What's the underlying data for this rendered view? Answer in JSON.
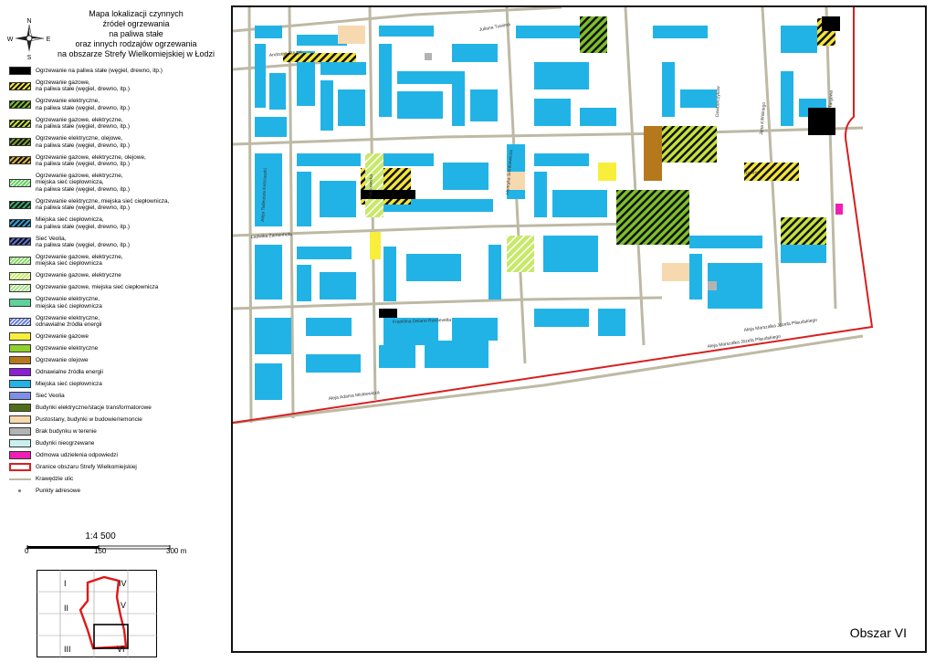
{
  "legend_title": [
    "Mapa lokalizacji czynnych",
    "źródeł ogrzewania",
    "na paliwa stałe",
    "oraz innych rodzajów ogrzewania",
    "na obszarze Strefy Wielkomiejskiej w Łodzi"
  ],
  "compass": {
    "N": "N",
    "S": "S",
    "E": "E",
    "W": "W"
  },
  "legend": [
    {
      "lines": [
        "Ogrzewanie na paliwa stałe (węgiel, drewno, itp.)"
      ],
      "swatch": "solid",
      "color": "#000000"
    },
    {
      "lines": [
        "Ogrzewanie gazowe,",
        "na paliwa stałe (węgiel, drewno, itp.)"
      ],
      "swatch": "hatch",
      "color": "#f5e43a"
    },
    {
      "lines": [
        "Ogrzewanie elektryczne,",
        "na paliwa stałe (węgiel, drewno, itp.)"
      ],
      "swatch": "hatch",
      "color": "#7dbf2b"
    },
    {
      "lines": [
        "Ogrzewanie gazowe, elektryczne,",
        "na paliwa stałe (węgiel, drewno, itp.)"
      ],
      "swatch": "hatch",
      "color": "#c6e03c"
    },
    {
      "lines": [
        "Ogrzewanie elektryczne, olejowe,",
        "na paliwa stałe (węgiel, drewno, itp.)"
      ],
      "swatch": "hatch",
      "color": "#7a9a2a"
    },
    {
      "lines": [
        "Ogrzewanie gazowe, elektryczne, olejowe,",
        "na paliwa stałe (węgiel, drewno, itp.)"
      ],
      "swatch": "hatch",
      "color": "#d9b23a"
    },
    {
      "lines": [
        "Ogrzewanie gazowe, elektryczne,",
        "miejska sieć ciepłownicza,",
        "na paliwa stałe (węgiel, drewno, itp.)"
      ],
      "swatch": "light-hatch",
      "color": "#5fcf5f"
    },
    {
      "lines": [
        "Ogrzewanie elektryczne, miejska sieć ciepłownicza,",
        "na paliwa stałe (węgiel, drewno, itp.)"
      ],
      "swatch": "hatch",
      "color": "#3aa86a"
    },
    {
      "lines": [
        "Miejska sieć ciepłownicza,",
        "na paliwa stałe (węgiel, drewno, itp.)"
      ],
      "swatch": "hatch",
      "color": "#2f9fd8"
    },
    {
      "lines": [
        "Sieć Veolia,",
        "na paliwa stałe (węgiel, drewno, itp.)"
      ],
      "swatch": "hatch",
      "color": "#5a6fd0"
    },
    {
      "lines": [
        "Ogrzewanie gazowe, elektryczne,",
        "miejska sieć ciepłownicza"
      ],
      "swatch": "light-hatch",
      "color": "#8ad86a"
    },
    {
      "lines": [
        "Ogrzewanie gazowe, elektryczne"
      ],
      "swatch": "light-hatch",
      "color": "#c8e86a"
    },
    {
      "lines": [
        "Ogrzewanie gazowe, miejska sieć ciepłownicza"
      ],
      "swatch": "light-hatch",
      "color": "#a7e08a"
    },
    {
      "lines": [
        "Ogrzewanie elektryczne,",
        "miejska sieć ciepłownicza"
      ],
      "swatch": "solid",
      "color": "#5fd19a"
    },
    {
      "lines": [
        "Ogrzewanie elektryczne,",
        "odnawialne źródła energii"
      ],
      "swatch": "light-hatch",
      "color": "#6a7de0"
    },
    {
      "lines": [
        "Ogrzewanie gazowe"
      ],
      "swatch": "solid",
      "color": "#f7ef3a"
    },
    {
      "lines": [
        "Ogrzewanie elektryczne"
      ],
      "swatch": "solid",
      "color": "#8fd12b"
    },
    {
      "lines": [
        "Ogrzewanie olejowe"
      ],
      "swatch": "solid",
      "color": "#b5781c"
    },
    {
      "lines": [
        "Odnawialne źródła energii"
      ],
      "swatch": "solid",
      "color": "#8a1fd6"
    },
    {
      "lines": [
        "Miejska sieć ciepłownicza"
      ],
      "swatch": "solid",
      "color": "#22b3e6"
    },
    {
      "lines": [
        "Sieć Veolia"
      ],
      "swatch": "solid",
      "color": "#7f8fe8"
    },
    {
      "lines": [
        "Budynki elektryczne/stacje transformatorowe"
      ],
      "swatch": "solid",
      "color": "#4f6e1a"
    },
    {
      "lines": [
        "Pustostany, budynki w budowie/remoncie"
      ],
      "swatch": "solid",
      "color": "#f7d9b0"
    },
    {
      "lines": [
        "Brak budynku w terenie"
      ],
      "swatch": "solid",
      "color": "#b3b3b3"
    },
    {
      "lines": [
        "Budynki nieogrzewane"
      ],
      "swatch": "solid",
      "color": "#c9f0f0"
    },
    {
      "lines": [
        "Odmowa udzielenia odpowiedzi"
      ],
      "swatch": "solid",
      "color": "#f01eb4"
    },
    {
      "lines": [
        "Granice obszaru Strefy Wielkomiejskiej"
      ],
      "swatch": "outline",
      "color": "#d62020"
    },
    {
      "lines": [
        "Krawędzie ulic"
      ],
      "swatch": "line",
      "color": "#bdb9a4"
    },
    {
      "lines": [
        "Punkty adresowe"
      ],
      "swatch": "dot",
      "color": "#777777"
    }
  ],
  "scale": {
    "ratio": "1:4 500",
    "tick0": "0",
    "tick150": "150",
    "tick300": "300 m"
  },
  "index_map": {
    "labels": [
      "I",
      "II",
      "III",
      "IV",
      "V",
      "VI"
    ]
  },
  "area_label": "Obszar VI",
  "streets": {
    "andrzeja": "Andrzeja Struga",
    "tuwima": "Juliana Tuwima",
    "zamenhofa": "Ludwika Zamenhofa",
    "sienkiewicza": "Henryka Sienkiewicza",
    "kosciuszki": "Aleja Tadeusza Kościuszki",
    "piotrkowska": "Piotrkowska",
    "roosevelta": "Franklina Delano Roosevelta",
    "mickiewicza": "Aleja Adama Mickiewicza",
    "pilsudskiego1": "Aleja Marszałka Józefa Piłsudskiego",
    "pilsudskiego2": "Aleja Marszałka Józefa Piłsudskiego",
    "nawrot": "Nawrot",
    "kilinskiego": "Jana Kilińskiego",
    "sterlinga": "Dowborczyków",
    "targowa": "Targowa"
  }
}
